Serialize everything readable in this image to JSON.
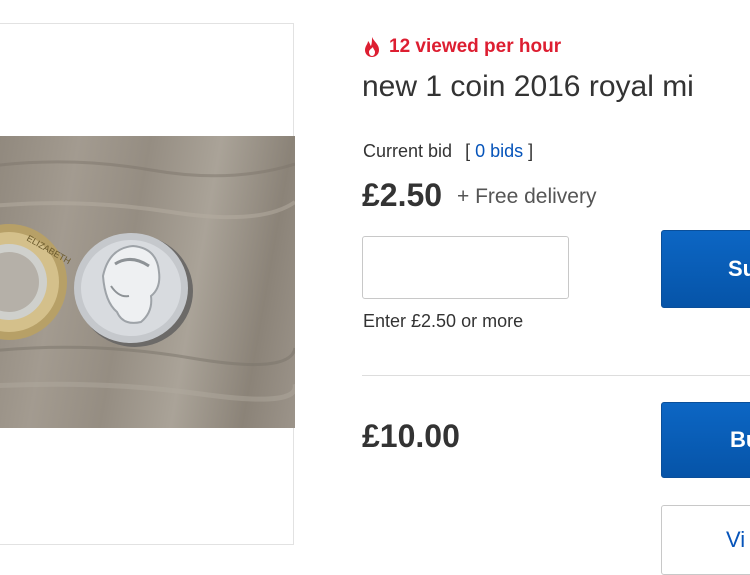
{
  "listing": {
    "views_text": "12 viewed per hour",
    "views_icon": "flame-icon",
    "title": "new 1 coin 2016 royal mi",
    "current_bid_label": "Current bid",
    "bids_open": "[",
    "bids_link": "0 bids",
    "bids_close": "]",
    "current_price": "£2.50",
    "delivery": "+ Free delivery",
    "bid_input_value": "",
    "enter_hint": "Enter £2.50 or more",
    "submit_button_label": "Su",
    "buy_now_price": "£10.00",
    "buy_now_button_label": "Bu",
    "view_button_label": "Vi"
  },
  "colors": {
    "alert_red": "#dd1e31",
    "link_blue": "#0654ba",
    "button_blue": "#0c66c4"
  }
}
